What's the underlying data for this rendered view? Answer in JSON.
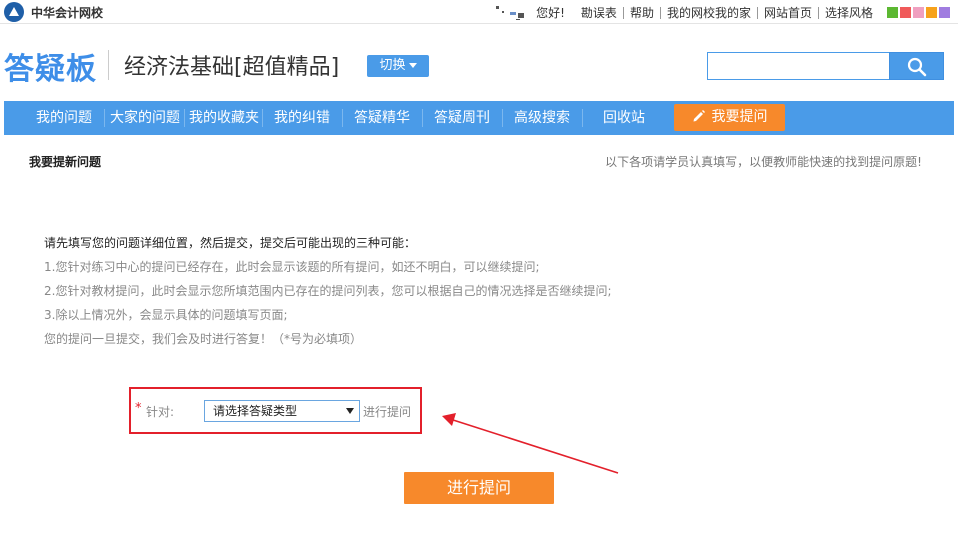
{
  "topbar": {
    "logo_text": "中华会计网校",
    "greeting": "您好!",
    "links": [
      "勘误表",
      "帮助",
      "我的网校我的家",
      "网站首页",
      "选择风格"
    ],
    "style_swatches": [
      "#5cb832",
      "#f05a5a",
      "#f0a0c0",
      "#f7a21b",
      "#a07ce0"
    ]
  },
  "header": {
    "brand": "答疑板",
    "course": "经济法基础[超值精品]",
    "switch_label": "切换",
    "search_value": "",
    "search_icon": "search-icon"
  },
  "nav": {
    "items": [
      "我的问题",
      "大家的问题",
      "我的收藏夹",
      "我的纠错",
      "答疑精华",
      "答疑周刊",
      "高级搜索",
      "回收站"
    ],
    "ask_label": "我要提问",
    "ask_icon": "pencil-icon"
  },
  "main": {
    "title": "我要提新问题",
    "hint": "以下各项请学员认真填写，以便教师能快速的找到提问原题!",
    "notice_head": "请先填写您的问题详细位置，然后提交，提交后可能出现的三种可能：",
    "notice_lines": [
      "1.您针对练习中心的提问已经存在，此时会显示该题的所有提问，如还不明白，可以继续提问;",
      "2.您针对教材提问，此时会显示您所填范围内已存在的提问列表，您可以根据自己的情况选择是否继续提问;",
      "3.除以上情况外，会显示具体的问题填写页面;",
      "您的提问一旦提交，我们会及时进行答复！（*号为必填项）"
    ]
  },
  "form": {
    "required_mark": "*",
    "label": "针对:",
    "select_value": "请选择答疑类型",
    "after_text": "进行提问",
    "submit_label": "进行提问"
  },
  "colors": {
    "accent": "#4a9be8",
    "orange": "#f7892b",
    "highlight": "#e3202b"
  }
}
